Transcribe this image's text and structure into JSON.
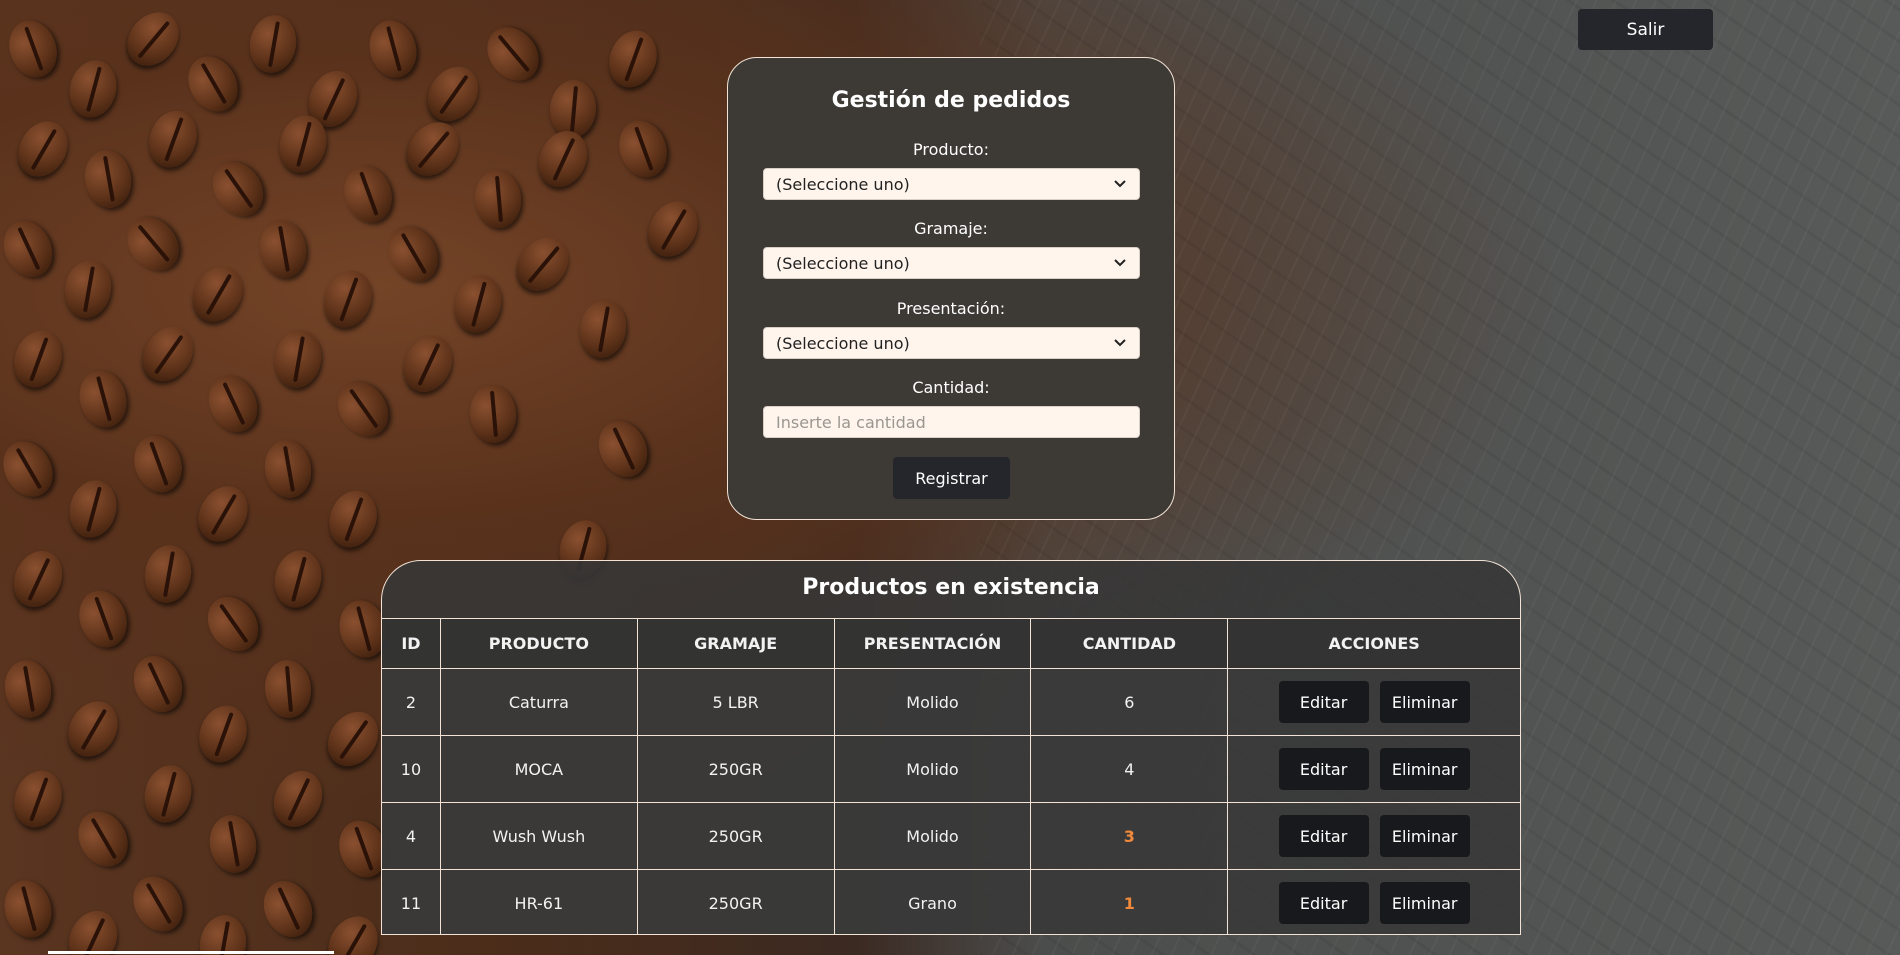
{
  "header": {
    "logout_label": "Salir"
  },
  "form": {
    "title": "Gestión de pedidos",
    "producto": {
      "label": "Producto:",
      "value": "(Seleccione uno)"
    },
    "gramaje": {
      "label": "Gramaje:",
      "value": "(Seleccione uno)"
    },
    "presentacion": {
      "label": "Presentación:",
      "value": "(Seleccione uno)"
    },
    "cantidad": {
      "label": "Cantidad:",
      "placeholder": "Inserte la cantidad"
    },
    "submit_label": "Registrar"
  },
  "table": {
    "title": "Productos en existencia",
    "columns": [
      "ID",
      "PRODUCTO",
      "GRAMAJE",
      "PRESENTACIÓN",
      "CANTIDAD",
      "ACCIONES"
    ],
    "edit_label": "Editar",
    "delete_label": "Eliminar",
    "rows": [
      {
        "id": "2",
        "producto": "Caturra",
        "gramaje": "5 LBR",
        "presentacion": "Molido",
        "cantidad": "6",
        "low_stock": false
      },
      {
        "id": "10",
        "producto": "MOCA",
        "gramaje": "250GR",
        "presentacion": "Molido",
        "cantidad": "4",
        "low_stock": false
      },
      {
        "id": "4",
        "producto": "Wush Wush",
        "gramaje": "250GR",
        "presentacion": "Molido",
        "cantidad": "3",
        "low_stock": true
      },
      {
        "id": "11",
        "producto": "HR-61",
        "gramaje": "250GR",
        "presentacion": "Grano",
        "cantidad": "1",
        "low_stock": true
      }
    ]
  },
  "colors": {
    "low_stock": "#f0893a",
    "card_bg": "#3d3a36",
    "border": "#f3e3d6",
    "button_bg": "#25262b"
  }
}
